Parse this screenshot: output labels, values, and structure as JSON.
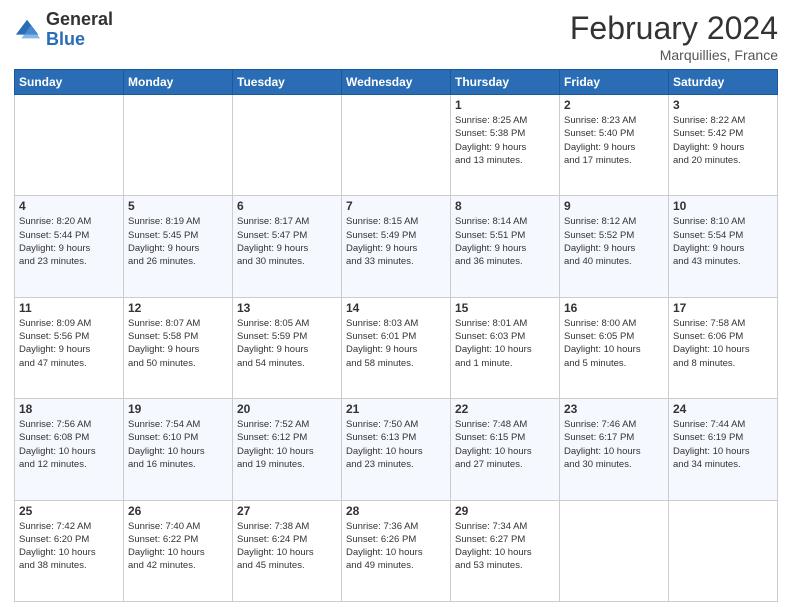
{
  "logo": {
    "general": "General",
    "blue": "Blue"
  },
  "header": {
    "month_year": "February 2024",
    "location": "Marquillies, France"
  },
  "weekdays": [
    "Sunday",
    "Monday",
    "Tuesday",
    "Wednesday",
    "Thursday",
    "Friday",
    "Saturday"
  ],
  "weeks": [
    [
      {
        "day": "",
        "info": ""
      },
      {
        "day": "",
        "info": ""
      },
      {
        "day": "",
        "info": ""
      },
      {
        "day": "",
        "info": ""
      },
      {
        "day": "1",
        "info": "Sunrise: 8:25 AM\nSunset: 5:38 PM\nDaylight: 9 hours\nand 13 minutes."
      },
      {
        "day": "2",
        "info": "Sunrise: 8:23 AM\nSunset: 5:40 PM\nDaylight: 9 hours\nand 17 minutes."
      },
      {
        "day": "3",
        "info": "Sunrise: 8:22 AM\nSunset: 5:42 PM\nDaylight: 9 hours\nand 20 minutes."
      }
    ],
    [
      {
        "day": "4",
        "info": "Sunrise: 8:20 AM\nSunset: 5:44 PM\nDaylight: 9 hours\nand 23 minutes."
      },
      {
        "day": "5",
        "info": "Sunrise: 8:19 AM\nSunset: 5:45 PM\nDaylight: 9 hours\nand 26 minutes."
      },
      {
        "day": "6",
        "info": "Sunrise: 8:17 AM\nSunset: 5:47 PM\nDaylight: 9 hours\nand 30 minutes."
      },
      {
        "day": "7",
        "info": "Sunrise: 8:15 AM\nSunset: 5:49 PM\nDaylight: 9 hours\nand 33 minutes."
      },
      {
        "day": "8",
        "info": "Sunrise: 8:14 AM\nSunset: 5:51 PM\nDaylight: 9 hours\nand 36 minutes."
      },
      {
        "day": "9",
        "info": "Sunrise: 8:12 AM\nSunset: 5:52 PM\nDaylight: 9 hours\nand 40 minutes."
      },
      {
        "day": "10",
        "info": "Sunrise: 8:10 AM\nSunset: 5:54 PM\nDaylight: 9 hours\nand 43 minutes."
      }
    ],
    [
      {
        "day": "11",
        "info": "Sunrise: 8:09 AM\nSunset: 5:56 PM\nDaylight: 9 hours\nand 47 minutes."
      },
      {
        "day": "12",
        "info": "Sunrise: 8:07 AM\nSunset: 5:58 PM\nDaylight: 9 hours\nand 50 minutes."
      },
      {
        "day": "13",
        "info": "Sunrise: 8:05 AM\nSunset: 5:59 PM\nDaylight: 9 hours\nand 54 minutes."
      },
      {
        "day": "14",
        "info": "Sunrise: 8:03 AM\nSunset: 6:01 PM\nDaylight: 9 hours\nand 58 minutes."
      },
      {
        "day": "15",
        "info": "Sunrise: 8:01 AM\nSunset: 6:03 PM\nDaylight: 10 hours\nand 1 minute."
      },
      {
        "day": "16",
        "info": "Sunrise: 8:00 AM\nSunset: 6:05 PM\nDaylight: 10 hours\nand 5 minutes."
      },
      {
        "day": "17",
        "info": "Sunrise: 7:58 AM\nSunset: 6:06 PM\nDaylight: 10 hours\nand 8 minutes."
      }
    ],
    [
      {
        "day": "18",
        "info": "Sunrise: 7:56 AM\nSunset: 6:08 PM\nDaylight: 10 hours\nand 12 minutes."
      },
      {
        "day": "19",
        "info": "Sunrise: 7:54 AM\nSunset: 6:10 PM\nDaylight: 10 hours\nand 16 minutes."
      },
      {
        "day": "20",
        "info": "Sunrise: 7:52 AM\nSunset: 6:12 PM\nDaylight: 10 hours\nand 19 minutes."
      },
      {
        "day": "21",
        "info": "Sunrise: 7:50 AM\nSunset: 6:13 PM\nDaylight: 10 hours\nand 23 minutes."
      },
      {
        "day": "22",
        "info": "Sunrise: 7:48 AM\nSunset: 6:15 PM\nDaylight: 10 hours\nand 27 minutes."
      },
      {
        "day": "23",
        "info": "Sunrise: 7:46 AM\nSunset: 6:17 PM\nDaylight: 10 hours\nand 30 minutes."
      },
      {
        "day": "24",
        "info": "Sunrise: 7:44 AM\nSunset: 6:19 PM\nDaylight: 10 hours\nand 34 minutes."
      }
    ],
    [
      {
        "day": "25",
        "info": "Sunrise: 7:42 AM\nSunset: 6:20 PM\nDaylight: 10 hours\nand 38 minutes."
      },
      {
        "day": "26",
        "info": "Sunrise: 7:40 AM\nSunset: 6:22 PM\nDaylight: 10 hours\nand 42 minutes."
      },
      {
        "day": "27",
        "info": "Sunrise: 7:38 AM\nSunset: 6:24 PM\nDaylight: 10 hours\nand 45 minutes."
      },
      {
        "day": "28",
        "info": "Sunrise: 7:36 AM\nSunset: 6:26 PM\nDaylight: 10 hours\nand 49 minutes."
      },
      {
        "day": "29",
        "info": "Sunrise: 7:34 AM\nSunset: 6:27 PM\nDaylight: 10 hours\nand 53 minutes."
      },
      {
        "day": "",
        "info": ""
      },
      {
        "day": "",
        "info": ""
      }
    ]
  ]
}
